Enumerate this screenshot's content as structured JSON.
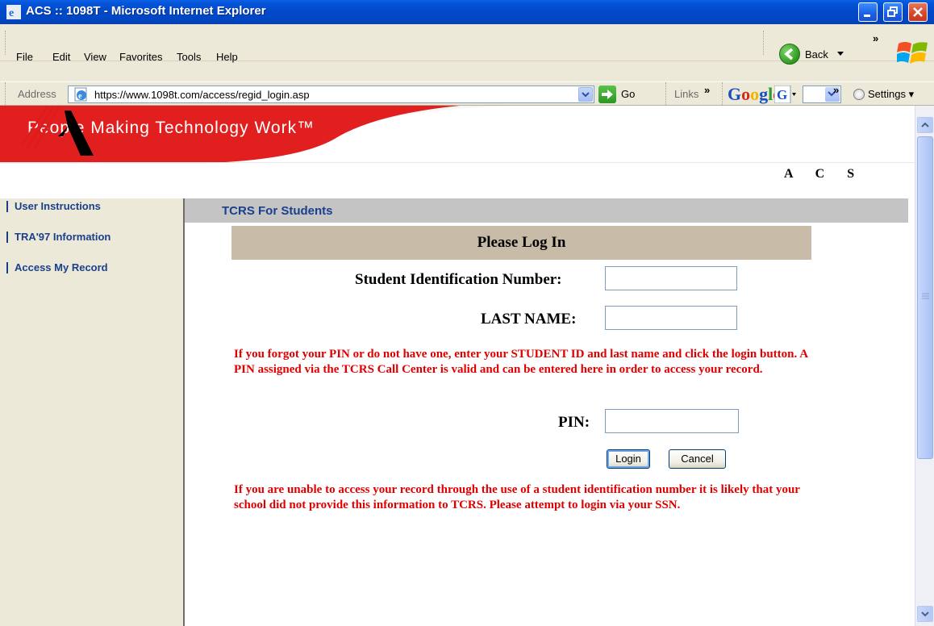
{
  "window": {
    "title": "ACS :: 1098T - Microsoft Internet Explorer"
  },
  "menu": {
    "items": [
      {
        "label": "File"
      },
      {
        "label": "Edit"
      },
      {
        "label": "View"
      },
      {
        "label": "Favorites"
      },
      {
        "label": "Tools"
      },
      {
        "label": "Help"
      }
    ],
    "back_label": "Back",
    "overflow": "»"
  },
  "address": {
    "label": "Address",
    "url": "https://www.1098t.com/access/regid_login.asp",
    "go_label": "Go",
    "links_label": "Links",
    "google_logo": "Google",
    "settings_label": "Settings"
  },
  "banner": {
    "tagline": "People Making Technology Work™",
    "logo_letters": "A    C    S"
  },
  "nav": {
    "items": [
      {
        "label": "User Instructions"
      },
      {
        "label": "TRA'97 Information"
      },
      {
        "label": "Access My Record"
      }
    ]
  },
  "section": {
    "title": "TCRS For Students"
  },
  "login": {
    "header": "Please Log In",
    "student_id_label": "Student Identification Number:",
    "student_id_value": "",
    "last_name_label": "LAST NAME:",
    "last_name_value": "",
    "pin_label": "PIN:",
    "pin_value": "",
    "login_button": "Login",
    "cancel_button": "Cancel",
    "pin_help": "If you forgot your PIN or do not have one, enter your STUDENT ID and last name and click the login button. A PIN assigned via the TCRS Call Center is valid and can be entered here in order to access your record.",
    "ssn_help": "If you are unable to access your record through the use of a student identification number it is likely that your school did not provide this information to TCRS. Please attempt to login via your SSN."
  },
  "colors": {
    "title_bar": "#0047c3",
    "banner_red": "#e01b1b",
    "nav_text": "#1a3f8c",
    "warning_text": "#e00000",
    "login_header_bg": "#c8bca8"
  }
}
